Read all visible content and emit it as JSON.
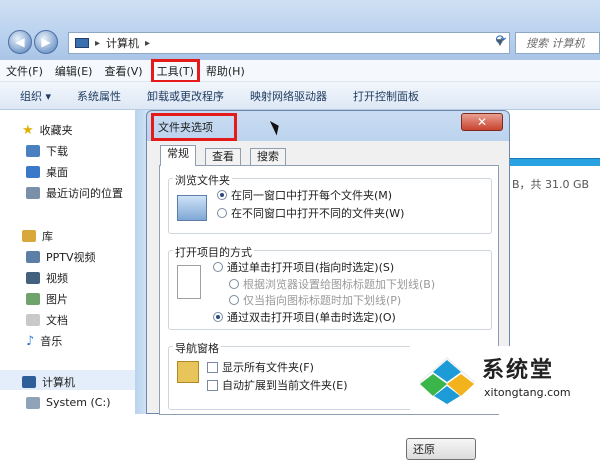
{
  "explorer": {
    "breadcrumb": [
      "计算机"
    ],
    "search_placeholder": "搜索 计算机",
    "menu": [
      "文件(F)",
      "编辑(E)",
      "查看(V)",
      "工具(T)",
      "帮助(H)"
    ],
    "toolbar": [
      "组织 ▾",
      "系统属性",
      "卸载或更改程序",
      "映射网络驱动器",
      "打开控制面板"
    ],
    "sidebar": {
      "favorites_label": "收藏夹",
      "favorites": [
        "下载",
        "桌面",
        "最近访问的位置"
      ],
      "library_label": "库",
      "libraries": [
        "PPTV视频",
        "视频",
        "图片",
        "文档",
        "音乐"
      ],
      "computer_label": "计算机",
      "drives": [
        "System (C:)"
      ]
    },
    "disk_info": "B，共 31.0 GB",
    "colors": {
      "accent": "#e51a1a",
      "bar": "#28a2e0"
    }
  },
  "dialog": {
    "title": "文件夹选项",
    "tabs": [
      "常规",
      "查看",
      "搜索"
    ],
    "browse": {
      "title": "浏览文件夹",
      "options": [
        "在同一窗口中打开每个文件夹(M)",
        "在不同窗口中打开不同的文件夹(W)"
      ]
    },
    "click": {
      "title": "打开项目的方式",
      "options": [
        "通过单击打开项目(指向时选定)(S)",
        "根据浏览器设置给图标标题加下划线(B)",
        "仅当指向图标标题时加下划线(P)",
        "通过双击打开项目(单击时选定)(O)"
      ]
    },
    "nav": {
      "title": "导航窗格",
      "options": [
        "显示所有文件夹(F)",
        "自动扩展到当前文件夹(E)"
      ]
    },
    "restore_label": "还原"
  },
  "watermark": {
    "title": "系统堂",
    "url": "xitongtang.com"
  }
}
